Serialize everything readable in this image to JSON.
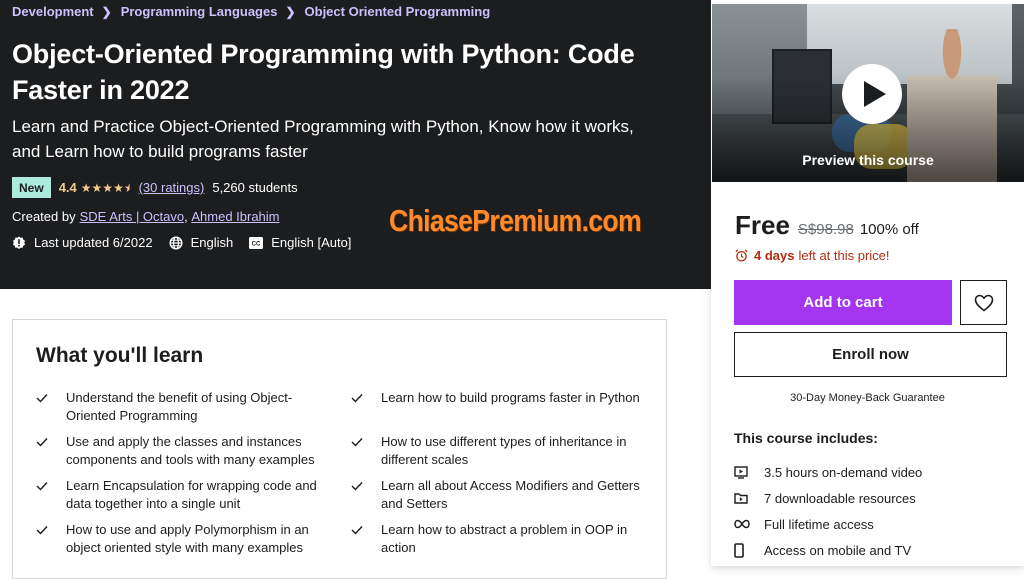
{
  "breadcrumb": [
    "Development",
    "Programming Languages",
    "Object Oriented Programming"
  ],
  "course": {
    "title": "Object-Oriented Programming with Python: Code Faster in 2022",
    "subtitle": "Learn and Practice Object-Oriented Programming with Python, Know how it works, and Learn how to build programs faster",
    "badge": "New",
    "rating": "4.4",
    "rating_value": 4.4,
    "rating_max": 5,
    "ratings_link": "(30 ratings)",
    "students": "5,260 students",
    "created_by_label": "Created by",
    "authors": [
      "SDE Arts | Octavo",
      "Ahmed Ibrahim"
    ],
    "last_updated": "Last updated 6/2022",
    "language": "English",
    "captions": "English [Auto]"
  },
  "watermark": "ChiasePremium.com",
  "sidebar": {
    "preview_label": "Preview this course",
    "price_now": "Free",
    "price_old": "S$98.98",
    "discount": "100% off",
    "timer_bold": "4 days",
    "timer_rest": "left at this price!",
    "add_to_cart": "Add to cart",
    "enroll_now": "Enroll now",
    "guarantee": "30-Day Money-Back Guarantee",
    "includes_title": "This course includes:",
    "includes": [
      {
        "icon": "video-icon",
        "label": "3.5 hours on-demand video"
      },
      {
        "icon": "download-folder-icon",
        "label": "7 downloadable resources"
      },
      {
        "icon": "infinity-icon",
        "label": "Full lifetime access"
      },
      {
        "icon": "mobile-icon",
        "label": "Access on mobile and TV"
      }
    ]
  },
  "learn": {
    "title": "What you'll learn",
    "items": [
      "Understand the benefit of using Object-Oriented Programming",
      "Learn how to build programs faster in Python",
      "Use and apply the classes and instances components and tools with many examples",
      "How to use different types of inheritance in different scales",
      "Learn Encapsulation for wrapping code and data together into a single unit",
      "Learn all about Access Modifiers and Getters and Setters",
      "How to use and apply Polymorphism in an object oriented style with many examples",
      "Learn how to abstract a problem in OOP in action"
    ]
  },
  "colors": {
    "hero_bg": "#1c1d1f",
    "breadcrumb": "#cec0fc",
    "star": "#f3ca8c",
    "badge_new": "#aceadb",
    "cart_button": "#a435f0",
    "timer": "#b32d0f",
    "watermark": "#ff8a2b"
  }
}
